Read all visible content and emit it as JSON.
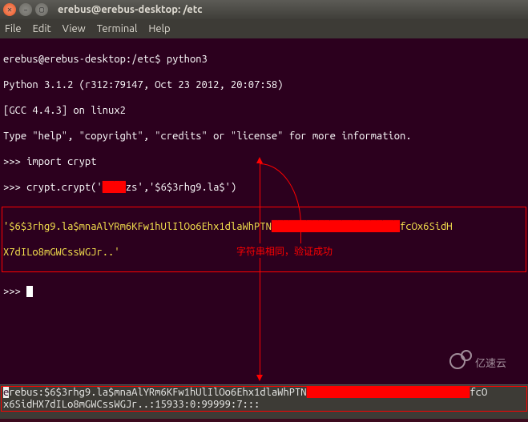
{
  "window": {
    "title": "erebus@erebus-desktop: /etc"
  },
  "menu": {
    "file": "File",
    "edit": "Edit",
    "view": "View",
    "terminal": "Terminal",
    "help": "Help"
  },
  "term": {
    "line1_prompt": "erebus@erebus-desktop:/etc$ ",
    "line1_cmd": "python3",
    "line2": "Python 3.1.2 (r312:79147, Oct 23 2012, 20:07:58)",
    "line3": "[GCC 4.4.3] on linux2",
    "line4": "Type \"help\", \"copyright\", \"credits\" or \"license\" for more information.",
    "line5_prompt": ">>> ",
    "line5_cmd": "import crypt",
    "line6_prompt": ">>> ",
    "line6_a": "crypt.crypt('",
    "line6_redact": "████",
    "line6_b": "zs','$6$3rhg9.la$')",
    "line7_a": "'$6$3rhg9.la$mnaAlYRm6KFw1hUlIlOo6Ehx1dlaWhPTN",
    "line7_redact": "██████████████████████",
    "line7_b": "fcOx6SidH",
    "line8": "X7dILo8mGWCssWGJr..'",
    "line9": ">>> "
  },
  "annotation": {
    "label": "字符串相同，验证成功"
  },
  "bottom": {
    "first_char": "e",
    "part_a": "rebus:$6$3rhg9.la$mnaAlYRm6KFw1hUlIlOo6Ehx1dlaWhPTN",
    "redact": "████████████████████████████",
    "part_b": "fcO",
    "line2": "x6SidHX7dILo8mGWCssWGJr..:15933:0:99999:7:::"
  },
  "watermark": {
    "text": "亿速云"
  }
}
